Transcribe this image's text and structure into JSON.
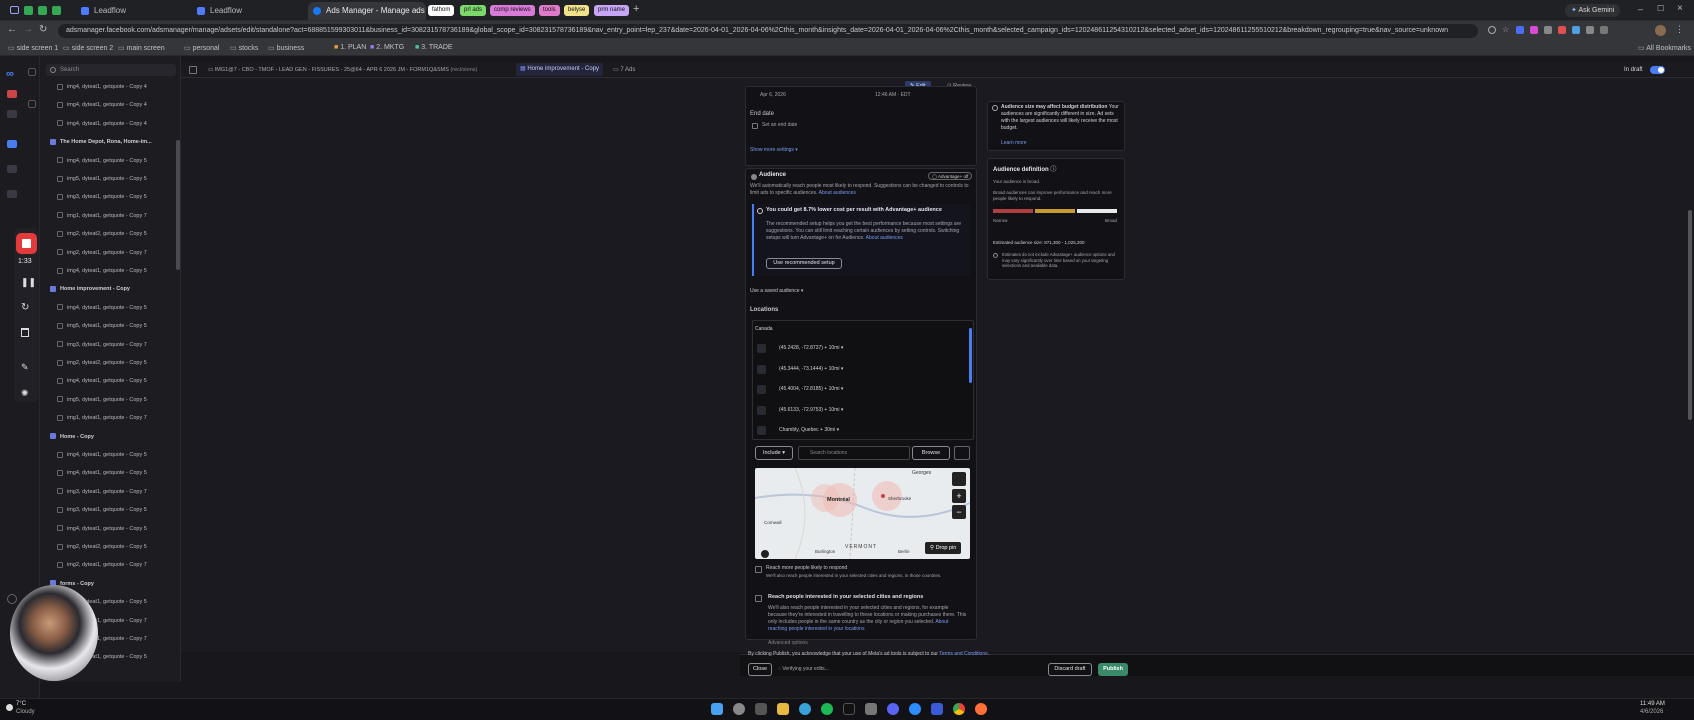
{
  "browser": {
    "tabs": [
      {
        "label": "Leadflow"
      },
      {
        "label": "Leadflow"
      },
      {
        "label": "Ads Manager - Manage ads - A"
      }
    ],
    "tab_pills": [
      {
        "label": "fathom",
        "color": "#ffffff"
      },
      {
        "label": "prl ads",
        "color": "#7bd96b"
      },
      {
        "label": "comp reviews",
        "color": "#d87ad8"
      },
      {
        "label": "tools",
        "color": "#e07acb"
      },
      {
        "label": "belyse",
        "color": "#f2e28a"
      },
      {
        "label": "prm name",
        "color": "#c7a6f5"
      }
    ],
    "ask_gemini": "Ask Gemini",
    "url": "adsmanager.facebook.com/adsmanager/manage/adsets/edit/standalone?act=688851599303011&business_id=308231578736189&global_scope_id=308231578736189&nav_entry_point=lep_237&date=2026-04-01_2026-04-06%2Cthis_month&insights_date=2026-04-01_2026-04-06%2Cthis_month&selected_campaign_ids=120248611254310212&selected_adset_ids=120248611255510212&breakdown_regrouping=true&nav_source=unknown",
    "bookmarks": [
      "side screen 1",
      "side screen 2",
      "main screen",
      "personal",
      "stocks",
      "business",
      "1. PLAN",
      "2. MKTG",
      "3. TRADE"
    ],
    "all_bookmarks": "All Bookmarks"
  },
  "tree": {
    "search_placeholder": "Search",
    "rows": [
      {
        "type": "ad",
        "label": "img4, dyteat1, getquote - Copy 4"
      },
      {
        "type": "ad",
        "label": "img4, dyteat1, getquote - Copy 4"
      },
      {
        "type": "ad",
        "label": "img4, dyteat1, getquote - Copy 4"
      },
      {
        "type": "group",
        "label": "The Home Depot, Rona, Home-im..."
      },
      {
        "type": "ad",
        "label": "img4, dyteat1, getquote - Copy 5"
      },
      {
        "type": "ad",
        "label": "img5, dyteat1, getquote - Copy 5"
      },
      {
        "type": "ad",
        "label": "img3, dyteat1, getquote - Copy 5"
      },
      {
        "type": "ad",
        "label": "img1, dyteat1, getquote - Copy 7"
      },
      {
        "type": "ad",
        "label": "img2, dyteat2, getquote - Copy 5"
      },
      {
        "type": "ad",
        "label": "img2, dyteat1, getquote - Copy 7"
      },
      {
        "type": "ad",
        "label": "img4, dyteat1, getquote - Copy 5"
      },
      {
        "type": "group",
        "label": "Home improvement - Copy"
      },
      {
        "type": "ad",
        "label": "img4, dyteat1, getquote - Copy 5"
      },
      {
        "type": "ad",
        "label": "img5, dyteat1, getquote - Copy 5"
      },
      {
        "type": "ad",
        "label": "img3, dyteat1, getquote - Copy 7"
      },
      {
        "type": "ad",
        "label": "img2, dyteat2, getquote - Copy 5"
      },
      {
        "type": "ad",
        "label": "img4, dyteat1, getquote - Copy 5"
      },
      {
        "type": "ad",
        "label": "img5, dyteat1, getquote - Copy 5"
      },
      {
        "type": "ad",
        "label": "img1, dyteat1, getquote - Copy 7"
      },
      {
        "type": "group",
        "label": "Home - Copy"
      },
      {
        "type": "ad",
        "label": "img4, dyteat1, getquote - Copy 5"
      },
      {
        "type": "ad",
        "label": "img4, dyteat1, getquote - Copy 5"
      },
      {
        "type": "ad",
        "label": "img3, dyteat1, getquote - Copy 7"
      },
      {
        "type": "ad",
        "label": "img3, dyteat1, getquote - Copy 5"
      },
      {
        "type": "ad",
        "label": "img4, dyteat1, getquote - Copy 5"
      },
      {
        "type": "ad",
        "label": "img2, dyteat2, getquote - Copy 5"
      },
      {
        "type": "ad",
        "label": "img2, dyteat1, getquote - Copy 7"
      },
      {
        "type": "group",
        "label": "forms - Copy"
      },
      {
        "type": "ad",
        "label": "img4, dyteat1, getquote - Copy 5"
      },
      {
        "type": "ad",
        "label": "img3, dyteat1, getquote - Copy 7"
      },
      {
        "type": "ad",
        "label": "img2, dyteat1, getquote - Copy 7"
      },
      {
        "type": "ad",
        "label": "img3, dyteat1, getquote - Copy 5"
      }
    ]
  },
  "recorder": {
    "time": "1:33"
  },
  "topbar": {
    "campaign": "IMG1@7 - CBO - TMOF - LEAD GEN - FISSURES - 25@64 - APR 6 2026 JM - FORM1Q&SMS",
    "campaign_badge": "(recl/sions)",
    "adset": "Home improvement - Copy",
    "ads": "7 Ads",
    "edit": "Edit",
    "review": "Review",
    "in_draft": "In draft"
  },
  "form": {
    "start_date": "Apr 6, 2026",
    "start_time": "12:46 AM · EDT",
    "end_date_label": "End date",
    "set_end_date": "Set an end date",
    "show_more": "Show more settings",
    "audience_title": "Audience",
    "advantage_toggle": "Advantage+ off",
    "audience_desc": "We'll automatically reach people most likely to respond. Suggestions can be changed to controls to limit ads to specific audiences.",
    "about_audiences": "About audiences",
    "reco_title": "You could get 8.7% lower cost per result with Advantage+ audience",
    "reco_body": "The recommended setup helps you get the best performance because most settings are suggestions. You can still limit reaching certain audiences by setting controls. Switching setups will turn Advantage+ on for Audience.",
    "reco_link": "About audiences",
    "reco_button": "Use recommended setup",
    "saved_audience": "Use a saved audience",
    "locations_label": "Locations",
    "country": "Canada",
    "locations": [
      "(45.2428, -72.8737) + 10mi",
      "(45.3444, -73.1444) + 10mi",
      "(45.4004, -72.8185) + 10mi",
      "(45.6133, -72.9753) + 10mi",
      "Chambly, Quebec + 30mi"
    ],
    "include": "Include",
    "search_locations": "Search locations",
    "browse": "Browse",
    "map_labels": [
      "Georges",
      "Sherbrooke",
      "Cornwall",
      "VERMONT",
      "Burlington",
      "Berlin",
      "Montréal"
    ],
    "drop_pin": "Drop pin",
    "reach_more_title": "Reach more people likely to respond",
    "reach_more_body": "We'll also reach people interested in your selected cities and regions, in those countries.",
    "interested_title": "Reach people interested in your selected cities and regions",
    "interested_body": "We'll also reach people interested in your selected cities and regions, for example because they're interested in travelling to these locations or making purchases there. This only includes people in the same country as the city or region you selected.",
    "interested_link": "About reaching people interested in your locations",
    "advanced": "Advanced options"
  },
  "side": {
    "budget_note": "Audience size may affect budget distribution",
    "budget_body": "Your audiences are significantly different in size. Ad sets with the largest audiences will likely receive the most budget.",
    "learn_more": "Learn more",
    "def_title": "Audience definition",
    "def_sub": "Your audience is broad.",
    "def_body": "Broad audiences can improve performance and reach more people likely to respond.",
    "narrow": "Narrow",
    "broad": "Broad",
    "est_size": "Estimated audience size: 871,300 - 1,025,200",
    "est_note": "Estimates do not include Advantage+ audience options and may vary significantly over time based on your targeting selections and available data."
  },
  "footer": {
    "notice": "By clicking Publish, you acknowledge that your use of Meta's ad tools is subject to our",
    "terms": "Terms and Conditions",
    "close": "Close",
    "verifying": "Verifying your edits...",
    "discard": "Discard draft",
    "publish": "Publish"
  },
  "taskbar": {
    "weather_temp": "7°C",
    "weather_desc": "Cloudy",
    "time": "11:49 AM",
    "date": "4/6/2026"
  },
  "colors": {
    "accent": "#4b7cf3",
    "publish": "#3a8a6a",
    "record": "#e23b3b"
  }
}
